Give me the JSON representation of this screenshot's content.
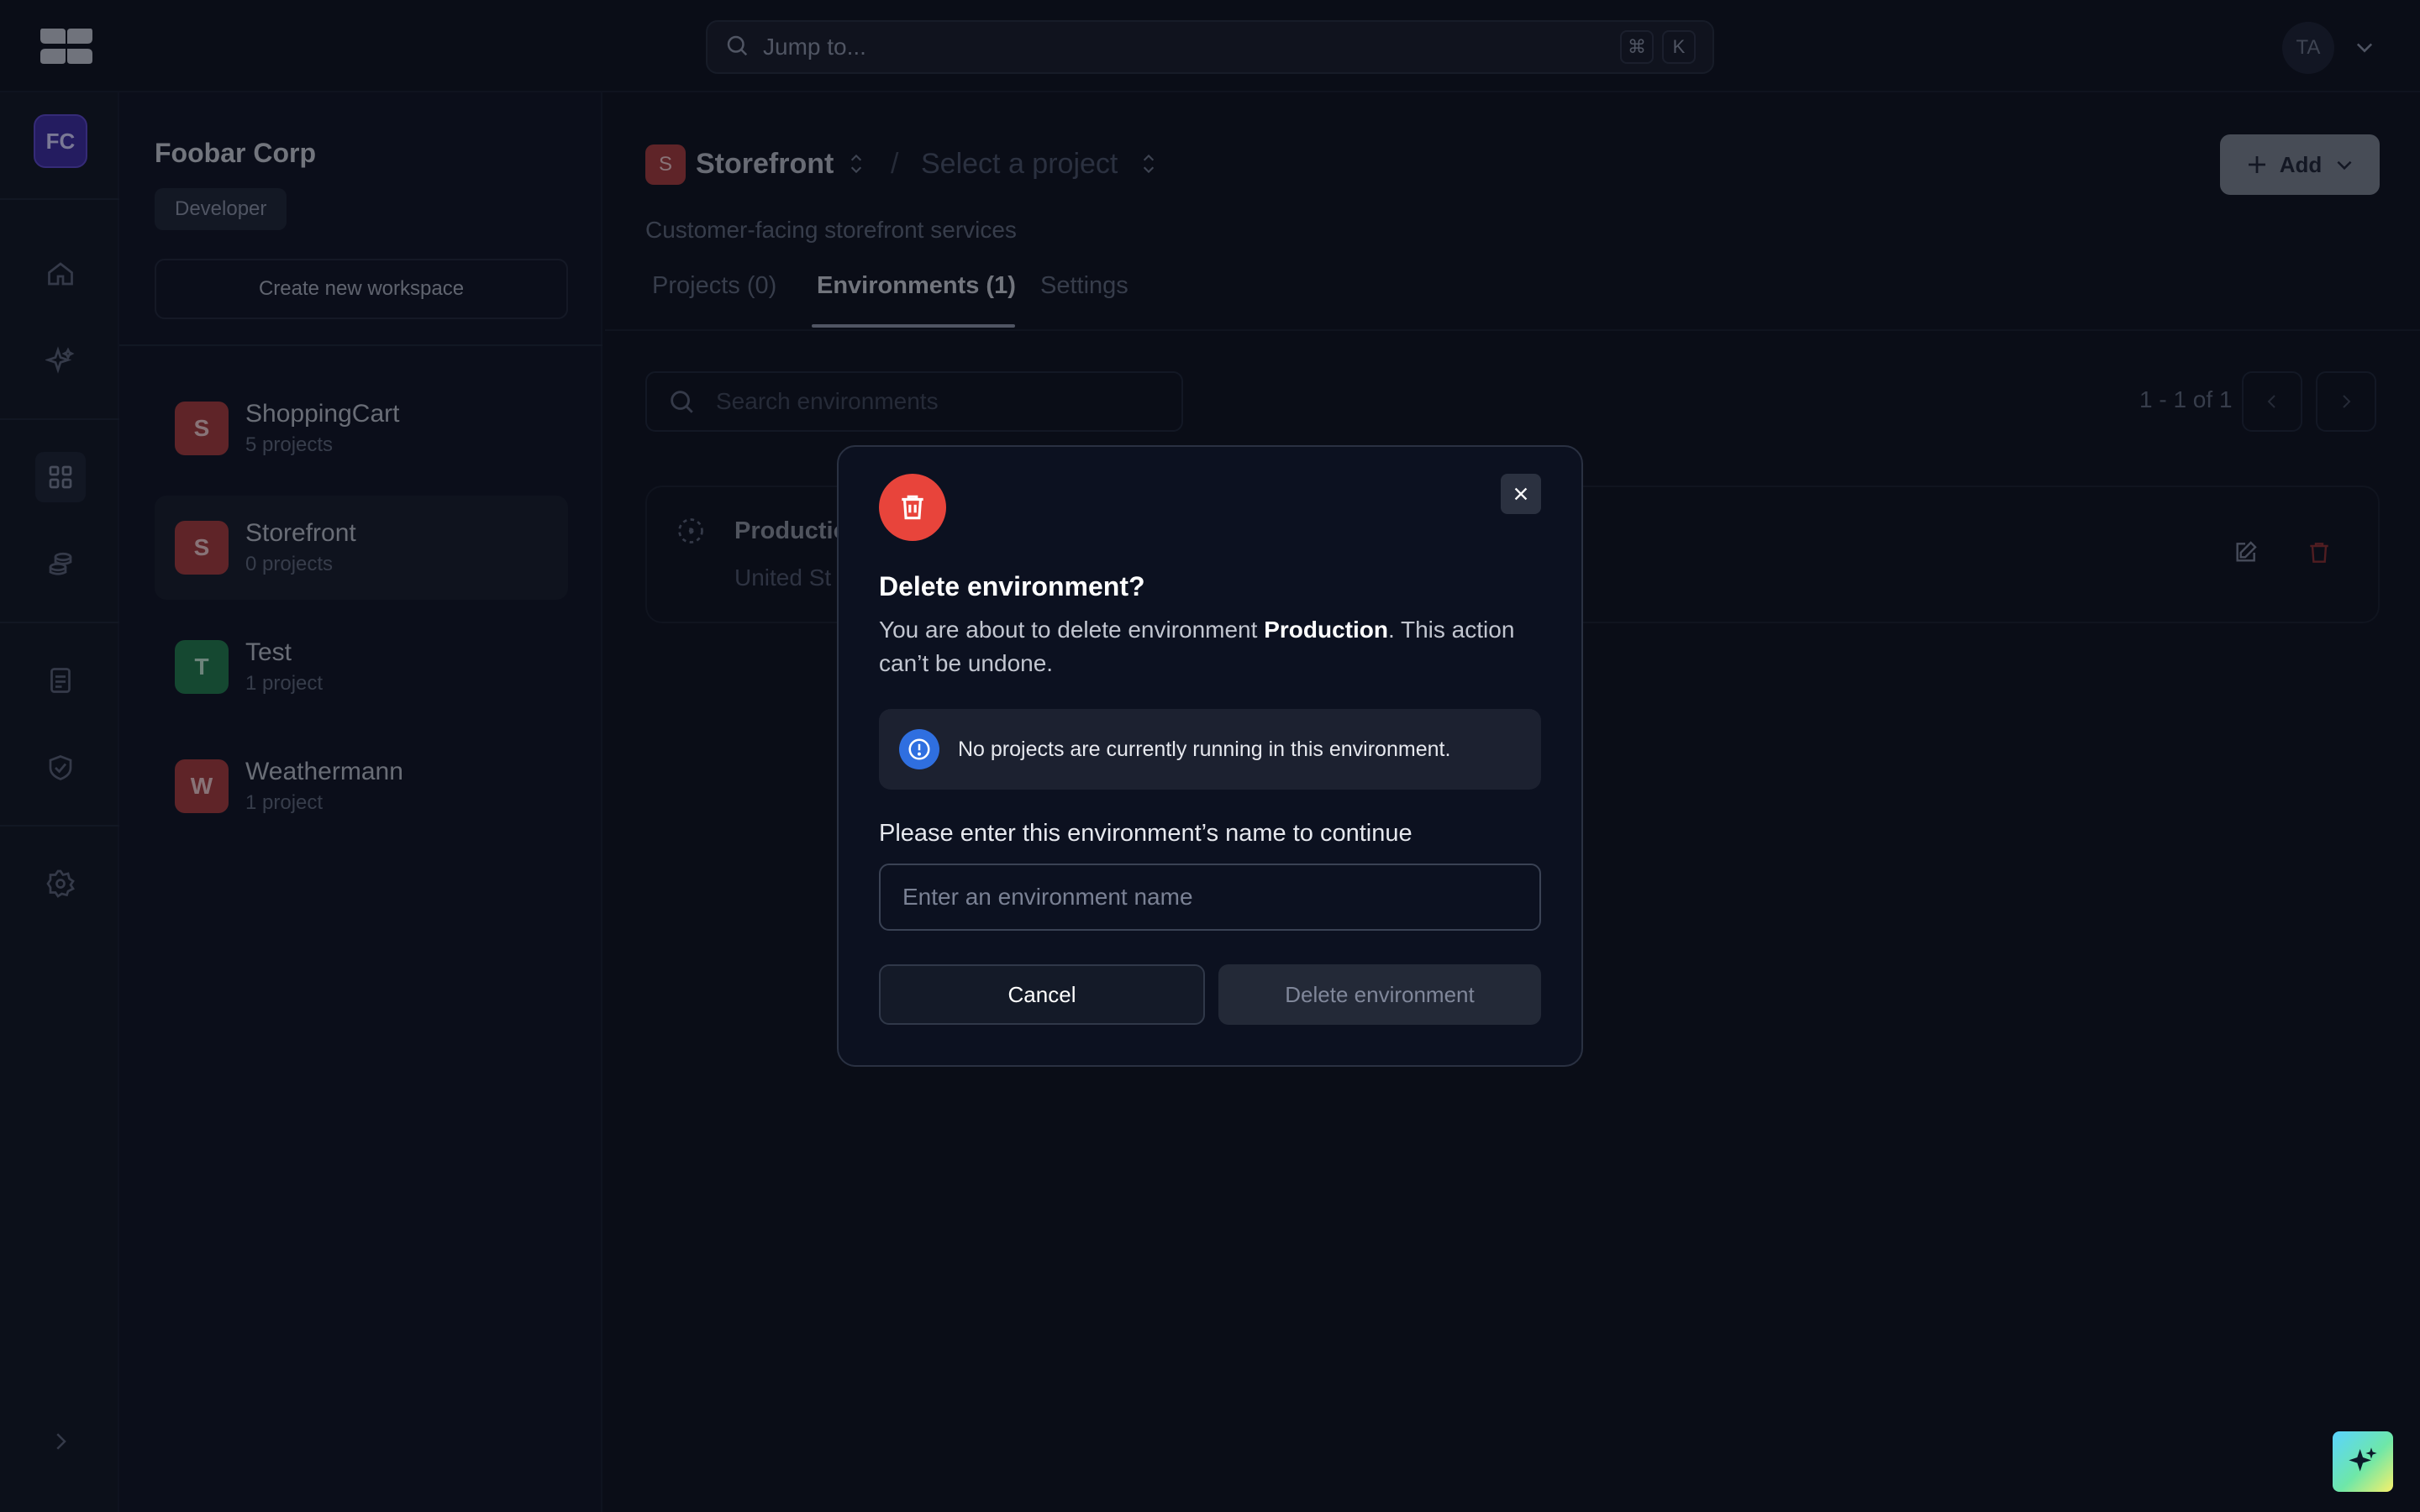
{
  "topbar": {
    "search_placeholder": "Jump to...",
    "shortcut_keys": [
      "⌘",
      "K"
    ],
    "user_initials": "TA"
  },
  "rail": {
    "org_initials": "FC",
    "icons": [
      "home-icon",
      "sparkle-icon",
      "grid-icon",
      "database-icon",
      "document-icon",
      "shield-check-icon",
      "gear-icon",
      "chevron-right-icon"
    ]
  },
  "workspace": {
    "name": "Foobar Corp",
    "role": "Developer",
    "create_label": "Create new workspace",
    "items": [
      {
        "initial": "S",
        "title": "ShoppingCart",
        "sub": "5 projects",
        "color": "#a63a3a"
      },
      {
        "initial": "S",
        "title": "Storefront",
        "sub": "0 projects",
        "color": "#a63a3a"
      },
      {
        "initial": "T",
        "title": "Test",
        "sub": "1 project",
        "color": "#1f7a4a"
      },
      {
        "initial": "W",
        "title": "Weathermann",
        "sub": "1 project",
        "color": "#a63a3a"
      }
    ]
  },
  "main": {
    "project_initial": "S",
    "project_name": "Storefront",
    "separator": "/",
    "select_project": "Select a project",
    "description": "Customer-facing storefront services",
    "tabs": {
      "projects": "Projects (0)",
      "environments": "Environments (1)",
      "settings": "Settings"
    },
    "add_label": "Add",
    "search_placeholder": "Search environments",
    "pager": "1 - 1 of 1",
    "environment": {
      "name": "Productio",
      "region": "United St"
    }
  },
  "modal": {
    "title": "Delete environment?",
    "desc_prefix": "You are about to delete environment ",
    "desc_name": "Production",
    "desc_suffix": ". This action can’t be undone.",
    "info": "No projects are currently running in this environment.",
    "confirm_label": "Please enter this environment’s name to continue",
    "input_placeholder": "Enter an environment name",
    "cancel_label": "Cancel",
    "delete_label": "Delete environment"
  },
  "colors": {
    "danger": "#e8443b",
    "info": "#2f6fe0",
    "org": "#3b2a9e"
  }
}
